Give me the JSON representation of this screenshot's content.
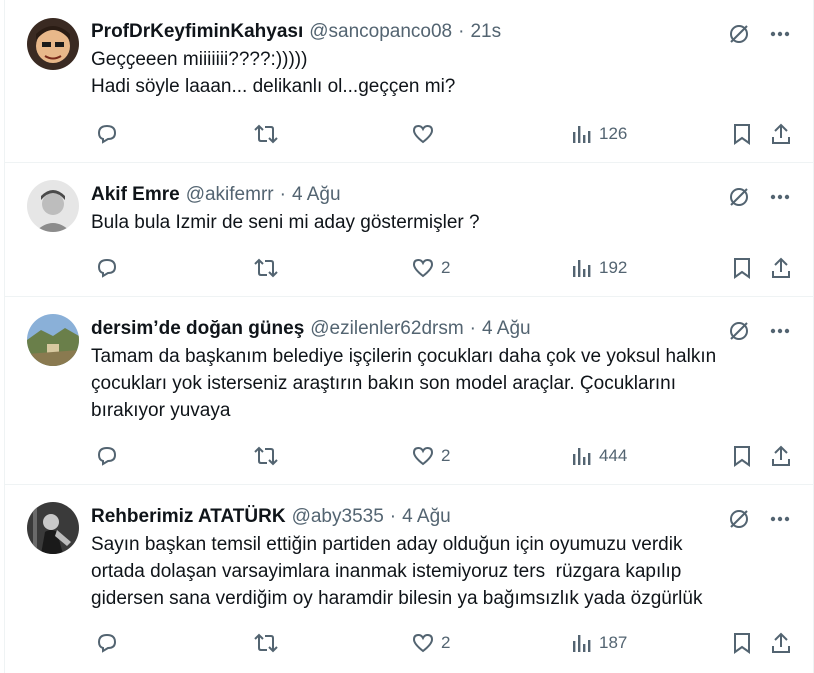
{
  "tweets": [
    {
      "name": "ProfDrKeyfiminKahyası",
      "handle": "@sancopanco08",
      "dot": "·",
      "time": "21s",
      "lines": [
        "Geçҫeeen miiiiiii????:)))))",
        "Hadi söyle laaan... delikanlı ol...geççen mi?"
      ],
      "likes": "",
      "views": "126",
      "avatar_color": "#3a2a22"
    },
    {
      "name": "Akif Emre",
      "handle": "@akifemrr",
      "dot": "·",
      "time": "4 Ağu",
      "lines": [
        "Bula bula Izmir de seni mi aday göstermişler ?"
      ],
      "likes": "2",
      "views": "192",
      "avatar_color": "#d9d9d9"
    },
    {
      "name": "dersim’de doğan güneş",
      "handle": "@ezilenler62drsm",
      "dot": "·",
      "time": "4 Ağu",
      "lines": [
        "Tamam da başkanım belediye işçilerin çocukları daha çok ve yoksul halkın",
        "çocukları yok isterseniz araştırın bakın son model araçlar. Çocuklarını",
        "bırakıyor yuvaya"
      ],
      "likes": "2",
      "views": "444",
      "avatar_color": "#6a7f4a"
    },
    {
      "name": "Rehberimiz ATATÜRK",
      "handle": "@aby3535",
      "dot": "·",
      "time": "4 Ağu",
      "lines": [
        "Sayın başkan temsil ettiğin partiden aday olduğun için oyumuzu verdik",
        "ortada dolaşan varsayimlara inanmak istemiyoruz ters  rüzgara kapılıp",
        "gidersen sana verdiğim oy haramdir bilesin ya bağımsızlık yada özgürlük"
      ],
      "likes": "2",
      "views": "187",
      "avatar_color": "#2b2b2b"
    }
  ],
  "icons": {
    "grok": "grok-icon",
    "more": "more-icon",
    "reply": "reply-icon",
    "retweet": "retweet-icon",
    "like": "like-icon",
    "views": "views-icon",
    "bookmark": "bookmark-icon",
    "share": "share-icon"
  },
  "colors": {
    "text": "#0f1419",
    "muted": "#536471",
    "border": "#eff3f4"
  }
}
